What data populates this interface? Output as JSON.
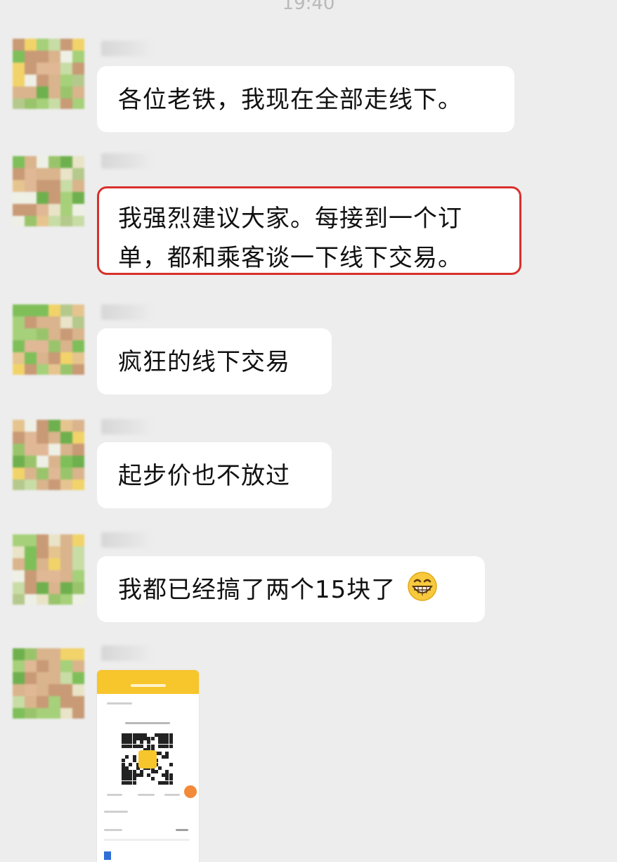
{
  "status": {
    "time": "19:40"
  },
  "messages": [
    {
      "text": "各位老铁，我现在全部走线下。",
      "highlighted": false
    },
    {
      "text": "我强烈建议大家。每接到一个订单，都和乘客谈一下线下交易。",
      "line1": "我强烈建议大家。每接到一个订",
      "line2": "单，都和乘客谈一下线下交易。",
      "highlighted": true
    },
    {
      "text": "疯狂的线下交易",
      "highlighted": false
    },
    {
      "text": "起步价也不放过",
      "highlighted": false
    },
    {
      "text": "我都已经搞了两个15块了",
      "emoji": "grinning-face-icon",
      "highlighted": false
    },
    {
      "type": "image",
      "content": "payment-qr-screenshot"
    }
  ],
  "colors": {
    "background": "#ededed",
    "bubble": "#ffffff",
    "highlight_border": "#d9302b",
    "qr_accent": "#f7c52c"
  }
}
